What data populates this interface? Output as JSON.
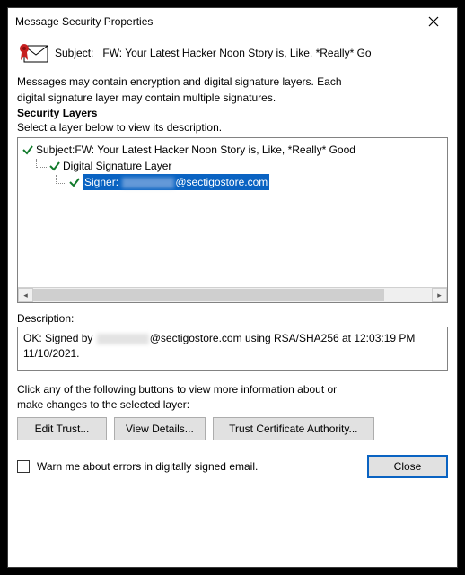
{
  "window": {
    "title": "Message Security Properties"
  },
  "subject": {
    "label": "Subject:",
    "value": "FW: Your Latest Hacker Noon Story is, Like, *Really* Go"
  },
  "info": {
    "line1": "Messages may contain encryption and digital signature layers. Each",
    "line2": "digital signature layer may contain multiple signatures."
  },
  "layers": {
    "heading": "Security Layers",
    "select_text": "Select a layer below to view its description.",
    "tree": {
      "row0_prefix": "Subject: ",
      "row0_value": "FW: Your Latest Hacker Noon Story is, Like, *Really* Good",
      "row1": "Digital Signature Layer",
      "row2_prefix": "Signer: ",
      "row2_suffix": "@sectigostore.com"
    }
  },
  "description": {
    "label": "Description:",
    "text_prefix": "OK: Signed by ",
    "text_suffix": "@sectigostore.com using RSA/SHA256 at 12:03:19 PM 11/10/2021."
  },
  "hint": {
    "line1": "Click any of the following buttons to view more information about or",
    "line2": "make changes to the selected layer:"
  },
  "buttons": {
    "edit_trust": "Edit Trust...",
    "view_details": "View Details...",
    "trust_ca": "Trust Certificate Authority..."
  },
  "bottom": {
    "checkbox_label": "Warn me about errors in digitally signed email.",
    "close": "Close"
  }
}
